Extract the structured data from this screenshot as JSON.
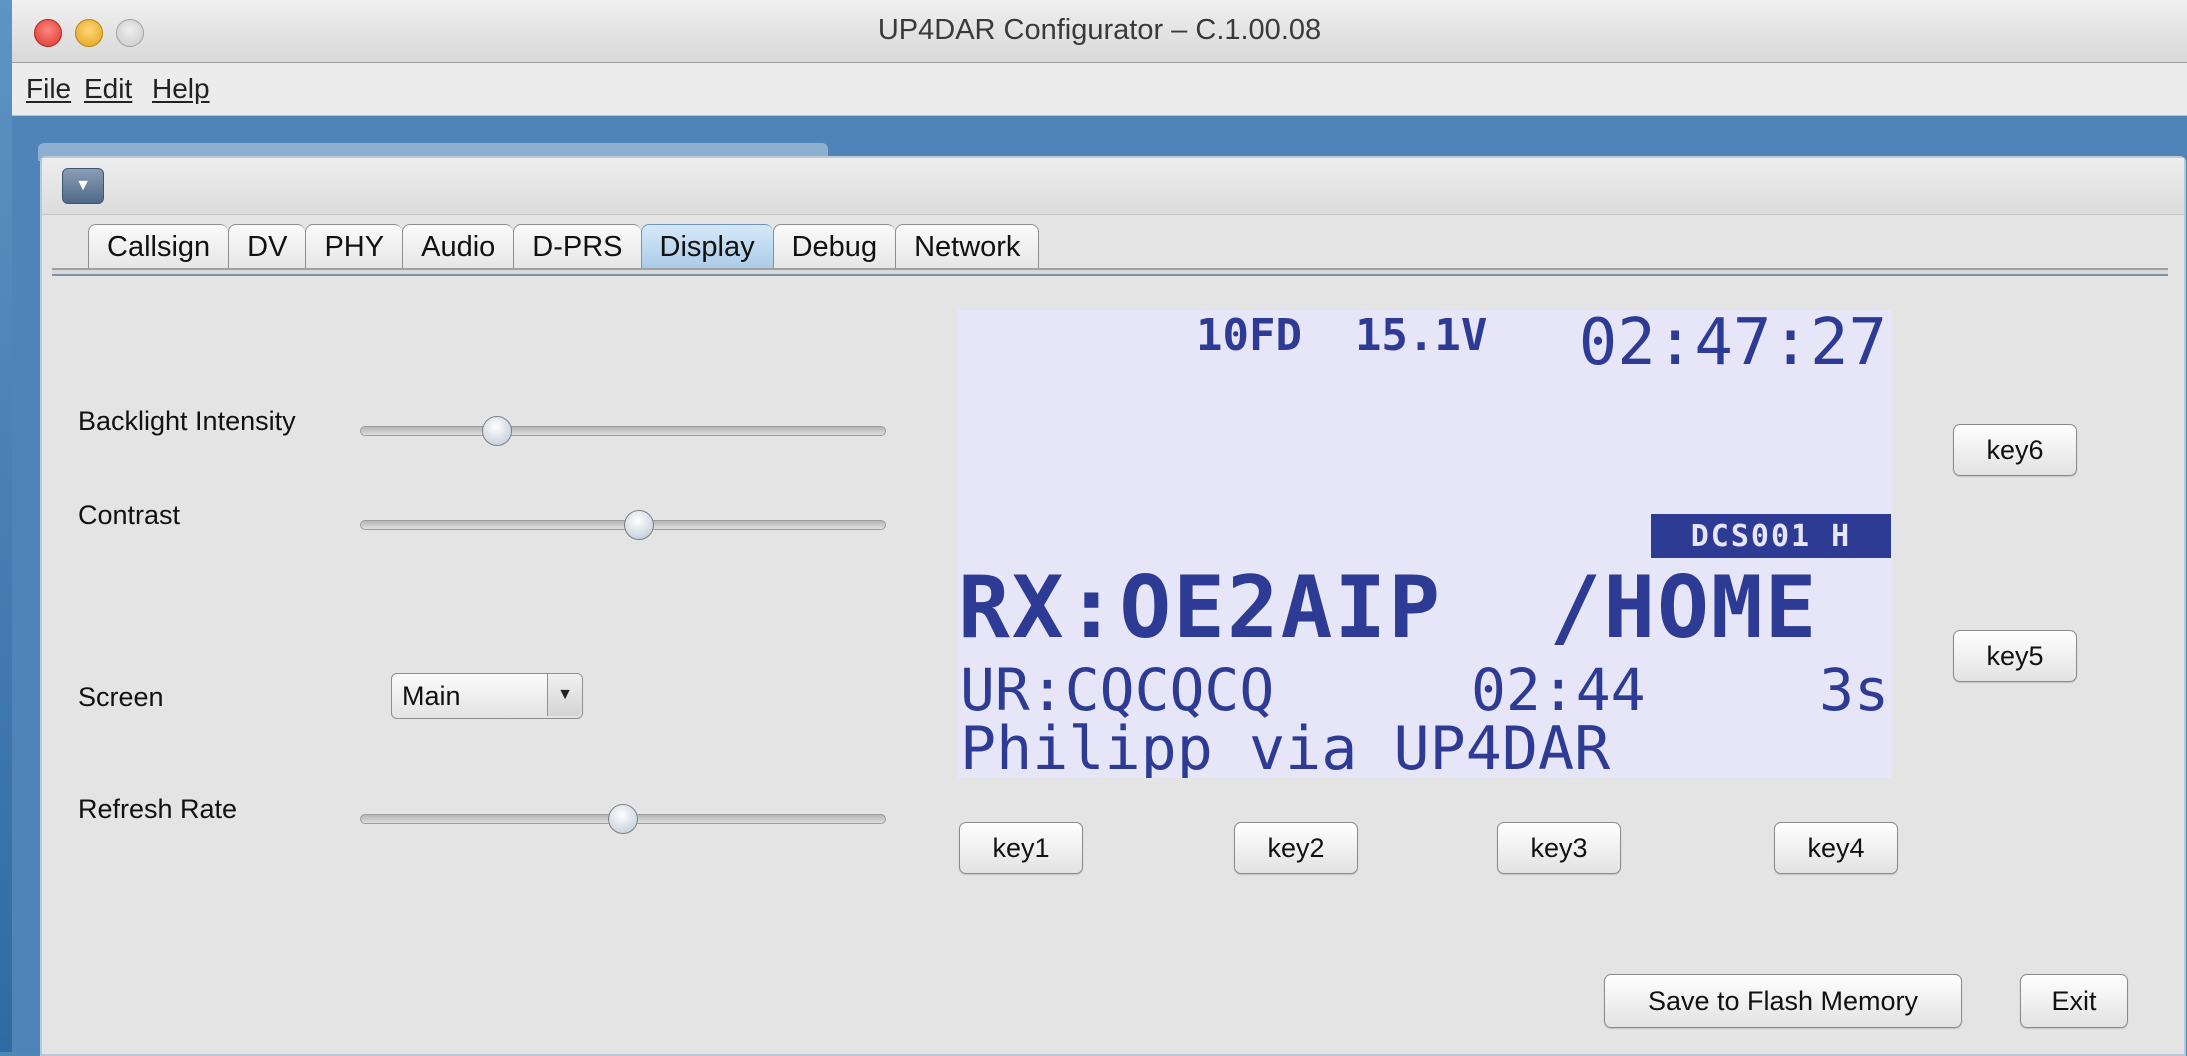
{
  "window": {
    "title": "UP4DAR Configurator – C.1.00.08"
  },
  "menu": {
    "file": "File",
    "edit": "Edit",
    "help": "Help"
  },
  "tabs": [
    {
      "label": "Callsign",
      "active": false
    },
    {
      "label": "DV",
      "active": false
    },
    {
      "label": "PHY",
      "active": false
    },
    {
      "label": "Audio",
      "active": false
    },
    {
      "label": "D-PRS",
      "active": false
    },
    {
      "label": "Display",
      "active": true
    },
    {
      "label": "Debug",
      "active": false
    },
    {
      "label": "Network",
      "active": false
    }
  ],
  "display_settings": {
    "backlight_label": "Backlight Intensity",
    "backlight_value": 0.26,
    "contrast_label": "Contrast",
    "contrast_value": 0.53,
    "screen_label": "Screen",
    "screen_value": "Main",
    "refresh_label": "Refresh Rate",
    "refresh_value": 0.5
  },
  "lcd": {
    "status_left": "10FD  15.1V",
    "clock": "02:47:27",
    "badge": "DCS001 H",
    "rx_line": "RX:OE2AIP  /HOME",
    "ur_line": "UR:CQCQCQ",
    "ur_time": "02:44",
    "ur_duration": "3s",
    "text_line": "Philipp via UP4DAR"
  },
  "keys": {
    "key1": "key1",
    "key2": "key2",
    "key3": "key3",
    "key4": "key4",
    "key5": "key5",
    "key6": "key6"
  },
  "actions": {
    "save": "Save to Flash Memory",
    "exit": "Exit"
  },
  "colors": {
    "lcd_bg": "#e6e6f8",
    "lcd_fg": "#2e3b95",
    "tab_active": "#a9cbe9"
  }
}
